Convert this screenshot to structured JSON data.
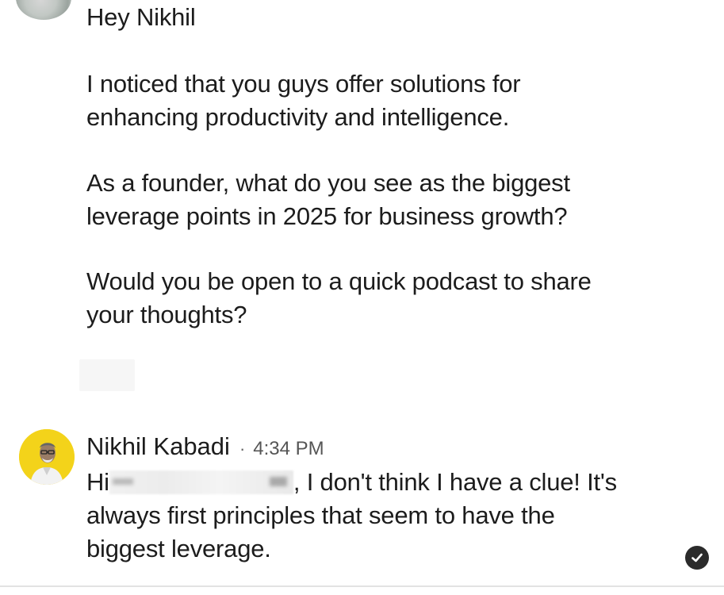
{
  "messages": {
    "first": {
      "greeting": "Hey Nikhil",
      "para1_line1": "I noticed that you guys offer solutions for",
      "para1_line2": "enhancing productivity and intelligence.",
      "para2_line1": "As a founder, what do you see as the biggest",
      "para2_line2": "leverage points in 2025 for business growth?",
      "para3_line1": "Would you be open to a quick podcast to share",
      "para3_line2": "your thoughts?"
    },
    "reply": {
      "sender_name": "Nikhil Kabadi",
      "separator": "·",
      "time": "4:34 PM",
      "hi": "Hi",
      "line1_rest": ", I don't think I have a clue! It's",
      "line2": "always first principles that seem to have the",
      "line3": "biggest leverage."
    }
  },
  "icons": {
    "read_status": "check-circle-icon"
  },
  "colors": {
    "avatar_background": "#f3d31a",
    "text": "#1c1c1c",
    "read_badge": "#2b2b2b"
  }
}
